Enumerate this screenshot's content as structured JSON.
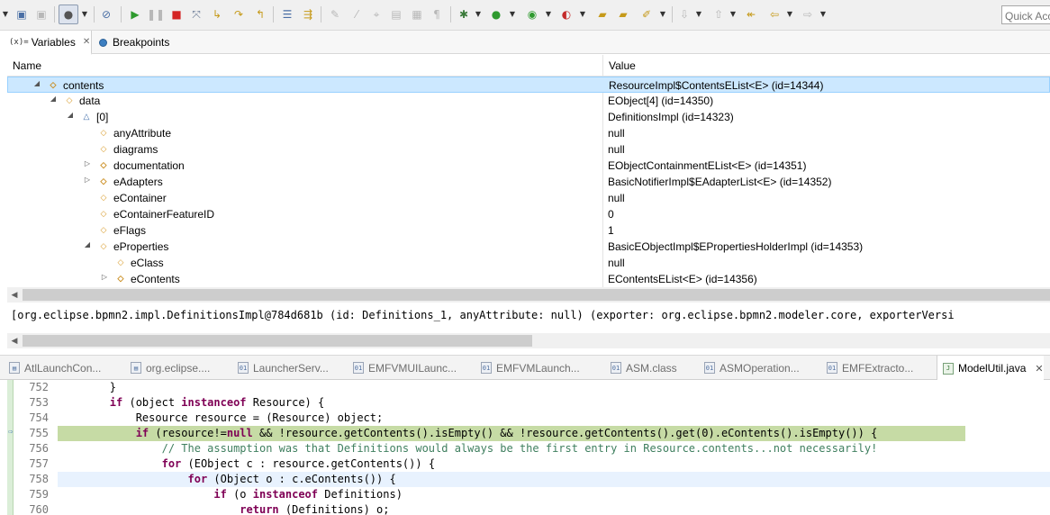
{
  "toolbar": {
    "icons": [
      "dropdown-arrow",
      "save-icon",
      "save-all-icon",
      "perspective-icon",
      "skip-breakpoints-icon",
      "resume-icon",
      "suspend-icon",
      "terminate-icon",
      "disconnect-icon",
      "step-into-icon",
      "step-over-icon",
      "step-return-icon",
      "drop-to-frame-icon",
      "use-step-filters-icon",
      "toggle-breakpoint-icon",
      "debug-icon",
      "run-icon",
      "coverage-icon",
      "external-tools-icon",
      "new-folder-icon",
      "open-folder-icon",
      "annotation-icon",
      "next-annotation-icon",
      "prev-annotation-icon",
      "back-icon",
      "forward-icon"
    ],
    "quick_access_placeholder": "Quick Acc"
  },
  "variables_view": {
    "tabs": [
      {
        "icon_text": "(x)=",
        "label": "Variables",
        "active": true
      },
      {
        "label": "Breakpoints",
        "active": false
      }
    ],
    "columns": {
      "name": "Name",
      "value": "Value"
    },
    "rows": [
      {
        "name": "contents",
        "value": "ResourceImpl$ContentsEList<E>  (id=14344)",
        "expanded": true,
        "icon": "collection-field-icon",
        "depth": 0,
        "selected": true
      },
      {
        "name": "data",
        "value": "EObject[4]  (id=14350)",
        "expanded": true,
        "icon": "field-icon",
        "depth": 1
      },
      {
        "name": "[0]",
        "value": "DefinitionsImpl  (id=14323)",
        "expanded": true,
        "icon": "array-element-icon",
        "depth": 2
      },
      {
        "name": "anyAttribute",
        "value": "null",
        "icon": "field-icon",
        "depth": 3
      },
      {
        "name": "diagrams",
        "value": "null",
        "icon": "field-icon",
        "depth": 3
      },
      {
        "name": "documentation",
        "value": "EObjectContainmentEList<E>  (id=14351)",
        "expanded": false,
        "icon": "collection-field-icon",
        "depth": 3
      },
      {
        "name": "eAdapters",
        "value": "BasicNotifierImpl$EAdapterList<E>  (id=14352)",
        "expanded": false,
        "icon": "collection-field-icon",
        "depth": 3
      },
      {
        "name": "eContainer",
        "value": "null",
        "icon": "field-icon",
        "depth": 3
      },
      {
        "name": "eContainerFeatureID",
        "value": "0",
        "icon": "field-icon",
        "depth": 3
      },
      {
        "name": "eFlags",
        "value": "1",
        "icon": "field-icon",
        "depth": 3
      },
      {
        "name": "eProperties",
        "value": "BasicEObjectImpl$EPropertiesHolderImpl  (id=14353)",
        "expanded": true,
        "icon": "field-icon",
        "depth": 3
      },
      {
        "name": "eClass",
        "value": "null",
        "icon": "field-icon",
        "depth": 4
      },
      {
        "name": "eContents",
        "value": "EContentsEList<E>  (id=14356)",
        "expanded": false,
        "icon": "collection-field-icon",
        "depth": 4
      }
    ],
    "detail_text": "[org.eclipse.bpmn2.impl.DefinitionsImpl@784d681b (id: Definitions_1, anyAttribute: null) (exporter: org.eclipse.bpmn2.modeler.core, exporterVersi"
  },
  "editor": {
    "tabs": [
      {
        "label": "AtlLaunchCon...",
        "icon": "file-icon"
      },
      {
        "label": "org.eclipse....",
        "icon": "file-icon"
      },
      {
        "label": "LauncherServ...",
        "icon": "class-file-icon"
      },
      {
        "label": "EMFVMUILaunc...",
        "icon": "class-file-icon"
      },
      {
        "label": "EMFVMLaunch...",
        "icon": "class-file-icon"
      },
      {
        "label": "ASM.class",
        "icon": "class-file-icon"
      },
      {
        "label": "ASMOperation...",
        "icon": "class-file-icon"
      },
      {
        "label": "EMFExtracto...",
        "icon": "class-file-icon"
      },
      {
        "label": "ModelUtil.java",
        "icon": "java-file-icon",
        "active": true
      }
    ],
    "lines": [
      {
        "number": "752",
        "code": "        }"
      },
      {
        "number": "753",
        "code": "        if (object instanceof Resource) {"
      },
      {
        "number": "754",
        "code": "            Resource resource = (Resource) object;"
      },
      {
        "number": "755",
        "code": "            if (resource!=null && !resource.getContents().isEmpty() && !resource.getContents().get(0).eContents().isEmpty()) {",
        "current": true
      },
      {
        "number": "756",
        "code": "                // The assumption was that Definitions would always be the first entry in Resource.contents...not necessarily!"
      },
      {
        "number": "757",
        "code": "                for (EObject c : resource.getContents()) {"
      },
      {
        "number": "758",
        "code": "                    for (Object o : c.eContents()) {",
        "highlighted": true
      },
      {
        "number": "759",
        "code": "                        if (o instanceof Definitions)"
      },
      {
        "number": "760",
        "code": "                            return (Definitions) o;"
      }
    ]
  }
}
